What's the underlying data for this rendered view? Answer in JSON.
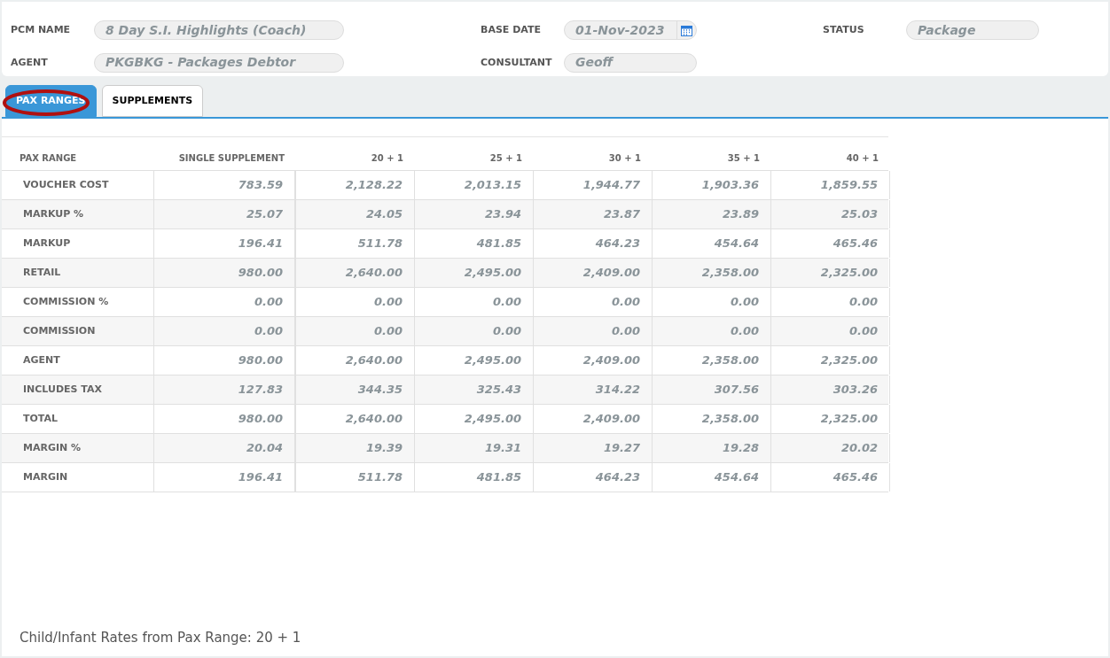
{
  "header": {
    "fields": [
      {
        "label": "PCM NAME",
        "value": "8 Day S.I. Highlights (Coach)",
        "kind": "text"
      },
      {
        "label": "BASE DATE",
        "value": "01-Nov-2023",
        "kind": "date"
      },
      {
        "label": "STATUS",
        "value": "Package",
        "kind": "text"
      },
      {
        "label": "AGENT",
        "value": "PKGBKG - Packages Debtor",
        "kind": "text"
      },
      {
        "label": "CONSULTANT",
        "value": "Geoff",
        "kind": "text"
      }
    ]
  },
  "tabs": [
    {
      "label": "PAX RANGES",
      "selected": true,
      "circled": true
    },
    {
      "label": "SUPPLEMENTS",
      "selected": false,
      "circled": false
    }
  ],
  "table": {
    "columns": [
      "PAX RANGE",
      "SINGLE SUPPLEMENT",
      "20 + 1",
      "25 + 1",
      "30 + 1",
      "35 + 1",
      "40 + 1"
    ],
    "rows": [
      {
        "cells": [
          "VOUCHER COST",
          "783.59",
          "2,128.22",
          "2,013.15",
          "1,944.77",
          "1,903.36",
          "1,859.55"
        ]
      },
      {
        "cells": [
          "MARKUP %",
          "25.07",
          "24.05",
          "23.94",
          "23.87",
          "23.89",
          "25.03"
        ]
      },
      {
        "cells": [
          "MARKUP",
          "196.41",
          "511.78",
          "481.85",
          "464.23",
          "454.64",
          "465.46"
        ]
      },
      {
        "cells": [
          "RETAIL",
          "980.00",
          "2,640.00",
          "2,495.00",
          "2,409.00",
          "2,358.00",
          "2,325.00"
        ]
      },
      {
        "cells": [
          "COMMISSION %",
          "0.00",
          "0.00",
          "0.00",
          "0.00",
          "0.00",
          "0.00"
        ]
      },
      {
        "cells": [
          "COMMISSION",
          "0.00",
          "0.00",
          "0.00",
          "0.00",
          "0.00",
          "0.00"
        ]
      },
      {
        "cells": [
          "AGENT",
          "980.00",
          "2,640.00",
          "2,495.00",
          "2,409.00",
          "2,358.00",
          "2,325.00"
        ]
      },
      {
        "cells": [
          "INCLUDES TAX",
          "127.83",
          "344.35",
          "325.43",
          "314.22",
          "307.56",
          "303.26"
        ]
      },
      {
        "cells": [
          "TOTAL",
          "980.00",
          "2,640.00",
          "2,495.00",
          "2,409.00",
          "2,358.00",
          "2,325.00"
        ]
      },
      {
        "cells": [
          "MARGIN %",
          "20.04",
          "19.39",
          "19.31",
          "19.27",
          "19.28",
          "20.02"
        ]
      },
      {
        "cells": [
          "MARGIN",
          "196.41",
          "511.78",
          "481.85",
          "464.23",
          "454.64",
          "465.46"
        ]
      }
    ]
  },
  "footer": "Child/Infant Rates from Pax Range: 20 + 1"
}
